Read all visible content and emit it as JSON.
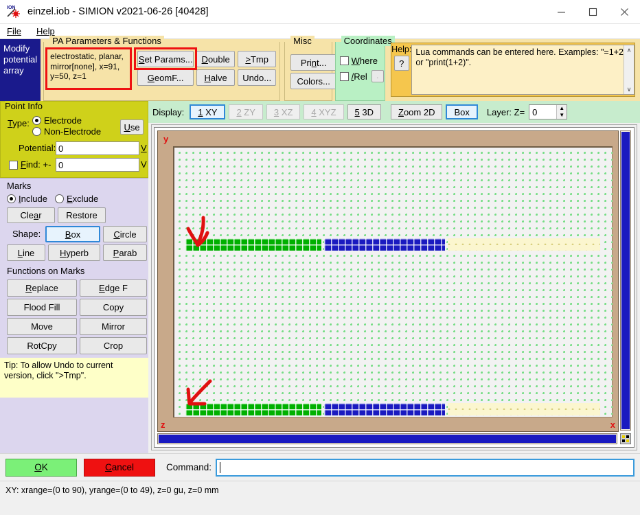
{
  "window": {
    "title": "einzel.iob - SIMION v2021-06-26 [40428]",
    "icon": "simion-ion-icon",
    "minimize": "minimize-icon",
    "maximize": "maximize-icon",
    "close": "close-icon"
  },
  "menu": {
    "items": [
      "File",
      "Help"
    ]
  },
  "mode_block": {
    "label": "Modify potential array"
  },
  "pa_group": {
    "title": "PA Parameters & Functions",
    "description": "electrostatic, planar, mirror[none], x=91, y=50, z=1",
    "buttons": [
      "Set Params...",
      "Double",
      ">Tmp",
      "GeomF...",
      "Halve",
      "Undo..."
    ],
    "highlight_color": "#ee1111"
  },
  "misc_group": {
    "title": "Misc",
    "buttons": [
      "Print...",
      "Colors..."
    ]
  },
  "coordinates_group": {
    "title": "Coordinates",
    "checkboxes": [
      {
        "label": "Where",
        "checked": false
      },
      {
        "label": "/Rel",
        "checked": false
      }
    ],
    "small_button": "."
  },
  "help_group": {
    "label": "Help:",
    "question_button": "?",
    "text": "Lua commands can be entered here.  Examples: \"=1+2\" or \"print(1+2)\".",
    "scroll_up": "∧",
    "scroll_down": "∨"
  },
  "point_info": {
    "title": "Point Info",
    "type_label": "Type:",
    "options": [
      {
        "label": "Electrode",
        "selected": true
      },
      {
        "label": "Non-Electrode",
        "selected": false
      }
    ],
    "use_button": "Use",
    "potential_label": "Potential:",
    "potential_value": "0",
    "potential_unit": "V",
    "find_label": "Find: +-",
    "find_checked": false,
    "find_value": "0",
    "find_unit": "V"
  },
  "marks": {
    "title": "Marks",
    "options": [
      {
        "label": "Include",
        "selected": true
      },
      {
        "label": "Exclude",
        "selected": false
      }
    ],
    "buttons": [
      "Clear",
      "Restore"
    ],
    "shape_label": "Shape:",
    "shapes": [
      {
        "label": "Box",
        "selected": true
      },
      {
        "label": "Circle",
        "selected": false
      },
      {
        "label": "Line",
        "selected": false
      },
      {
        "label": "Hyperb",
        "selected": false
      },
      {
        "label": "Parab",
        "selected": false
      }
    ]
  },
  "functions_on_marks": {
    "title": "Functions on Marks",
    "buttons": [
      "Replace",
      "Edge F",
      "Flood Fill",
      "Copy",
      "Move",
      "Mirror",
      "RotCpy",
      "Crop"
    ]
  },
  "tip": {
    "text": "Tip: To allow Undo to current version, click \">Tmp\"."
  },
  "display_bar": {
    "label": "Display:",
    "tabs": [
      {
        "label": "1 XY",
        "state": "selected"
      },
      {
        "label": "2 ZY",
        "state": "disabled"
      },
      {
        "label": "3 XZ",
        "state": "disabled"
      },
      {
        "label": "4 XYZ",
        "state": "disabled"
      },
      {
        "label": "5 3D",
        "state": "normal"
      }
    ],
    "zoom_button": "Zoom 2D",
    "box_button": "Box",
    "box_selected": true,
    "layer_label": "Layer: Z=",
    "layer_value": "0"
  },
  "viewer": {
    "axis_y": "y",
    "axis_x": "x",
    "axis_z": "z",
    "annotations": [
      {
        "name": "arrow-down-upper-electrode"
      },
      {
        "name": "arrow-up-lower-electrode"
      }
    ],
    "electrodes": [
      {
        "green_label": "green-electrode",
        "blue_label": "blue-electrode",
        "yellow_label": "non-electrode-region"
      },
      {
        "green_label": "green-electrode",
        "blue_label": "blue-electrode",
        "yellow_label": "non-electrode-region"
      }
    ],
    "colors": {
      "electrode_green": "#00b000",
      "electrode_blue": "#1a1ac0",
      "grid_dot": "#77dd86",
      "frame": "#c8a98a",
      "scrollbar_thumb": "#1a1ac0"
    }
  },
  "bottom": {
    "ok": "OK",
    "cancel": "Cancel",
    "command_label": "Command:",
    "command_value": "",
    "command_placeholder": ""
  },
  "status": {
    "text": "XY: xrange=(0 to 90), yrange=(0 to 49), z=0 gu, z=0 mm"
  }
}
